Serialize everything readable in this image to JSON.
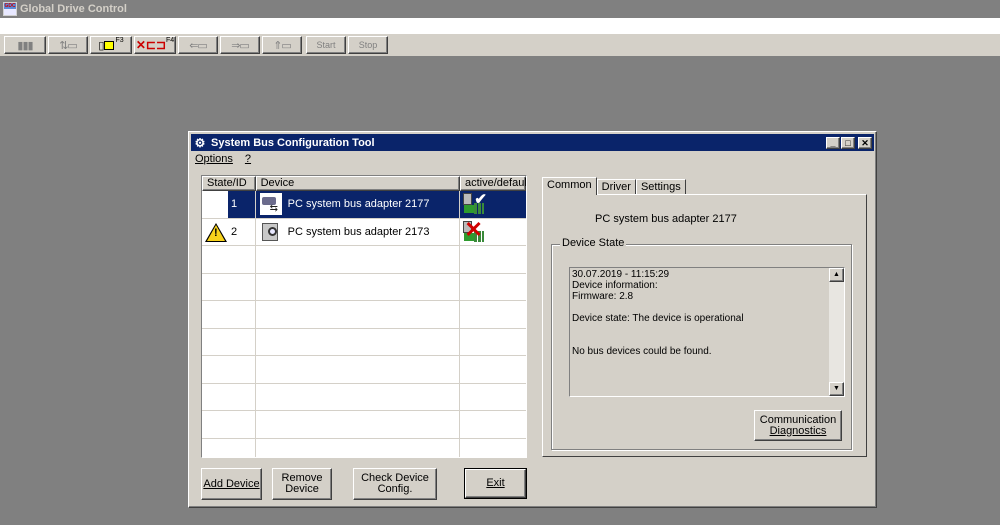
{
  "app": {
    "title": "Global Drive Control",
    "toolbar": {
      "start_label": "Start",
      "stop_label": "Stop",
      "f3_label": "F3",
      "f4_label": "F4"
    }
  },
  "dialog": {
    "title": "System Bus Configuration Tool",
    "window_controls": {
      "minimize": "_",
      "maximize": "□",
      "close": "✕"
    },
    "menu": [
      {
        "label": "Options"
      },
      {
        "label": "?"
      }
    ],
    "table": {
      "columns": [
        "State/ID",
        "Device",
        "active/default"
      ],
      "rows": [
        {
          "id": "1",
          "device": "PC system bus adapter 2177",
          "warning": false,
          "active": true,
          "selected": true
        },
        {
          "id": "2",
          "device": "PC system bus adapter 2173",
          "warning": true,
          "active": false,
          "selected": false
        },
        {
          "id": "",
          "device": ""
        },
        {
          "id": "",
          "device": ""
        },
        {
          "id": "",
          "device": ""
        },
        {
          "id": "",
          "device": ""
        },
        {
          "id": "",
          "device": ""
        },
        {
          "id": "",
          "device": ""
        },
        {
          "id": "",
          "device": ""
        },
        {
          "id": "",
          "device": ""
        }
      ]
    },
    "buttons": {
      "add_device": "Add Device",
      "remove_device_line1": "Remove",
      "remove_device_line2": "Device",
      "check_config_line1": "Check Device",
      "check_config_line2": "Config.",
      "exit": "Exit"
    },
    "tabs": [
      {
        "label": "Common",
        "active": true
      },
      {
        "label": "Driver",
        "active": false
      },
      {
        "label": "Settings",
        "active": false
      }
    ],
    "common": {
      "device_name": "PC system bus adapter 2177",
      "device_state_label": "Device State",
      "info_lines": [
        "30.07.2019 - 11:15:29",
        "Device information:",
        "Firmware: 2.8",
        "",
        "Device state: The device is operational",
        "",
        "",
        "No bus devices could be found."
      ],
      "comm_diag_line1": "Communication",
      "comm_diag_line2": "Diagnostics"
    }
  }
}
